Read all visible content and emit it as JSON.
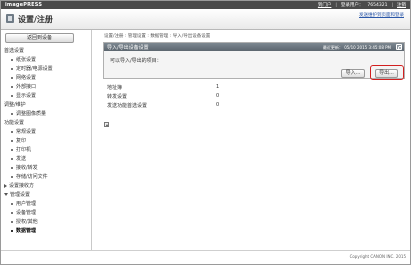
{
  "topbar": {
    "brand": "imagePRESS",
    "links": [
      "到门户",
      "登录用户：",
      "7654321",
      "注销"
    ]
  },
  "header": {
    "title": "设置/注册",
    "status_link": "发送维护到页面和登录"
  },
  "sidebar": {
    "home_button": "返回到设备",
    "items": [
      {
        "type": "section",
        "label": "首选设置"
      },
      {
        "type": "item",
        "label": "纸张设置"
      },
      {
        "type": "item",
        "label": "定时器/电源设置"
      },
      {
        "type": "item",
        "label": "网络设置"
      },
      {
        "type": "item",
        "label": "外部接口"
      },
      {
        "type": "item",
        "label": "显示设置"
      },
      {
        "type": "section",
        "label": "调整/维护"
      },
      {
        "type": "item",
        "label": "调整图像质量"
      },
      {
        "type": "section",
        "label": "功能设置"
      },
      {
        "type": "item",
        "label": "常规设置"
      },
      {
        "type": "item",
        "label": "复印"
      },
      {
        "type": "item",
        "label": "打印机"
      },
      {
        "type": "item",
        "label": "发送"
      },
      {
        "type": "item",
        "label": "接收/转发"
      },
      {
        "type": "item",
        "label": "存储/访问文件"
      },
      {
        "type": "section-collapsed",
        "label": "设置接收方"
      },
      {
        "type": "section",
        "label": "管理设置"
      },
      {
        "type": "item",
        "label": "用户管理"
      },
      {
        "type": "item",
        "label": "设备管理"
      },
      {
        "type": "item",
        "label": "授权/其他"
      },
      {
        "type": "item",
        "label": "数据管理",
        "active": true
      }
    ]
  },
  "main": {
    "breadcrumb": [
      "设置/注册",
      "管理设置",
      "数据管理",
      "导入/导出设备设置"
    ],
    "panel": {
      "title": "导入/导出设备设置",
      "updated_label": "最近更新：",
      "updated_value": "05/10 2015 3:45:08 PM",
      "description": "可以导入/导出的项目：",
      "import_button": "导入...",
      "export_button": "导出..."
    },
    "info": [
      {
        "label": "地址簿",
        "value": "1"
      },
      {
        "label": "转发设置",
        "value": "0"
      },
      {
        "label": "发送功能首选设置",
        "value": "0"
      }
    ]
  },
  "footer": {
    "copyright": "Copyright CANON INC. 2015"
  },
  "colors": {
    "topbar": "#4a4a4a",
    "panel_header": "#6b757e",
    "highlight": "#d21f1f",
    "link": "#2b57a8"
  }
}
